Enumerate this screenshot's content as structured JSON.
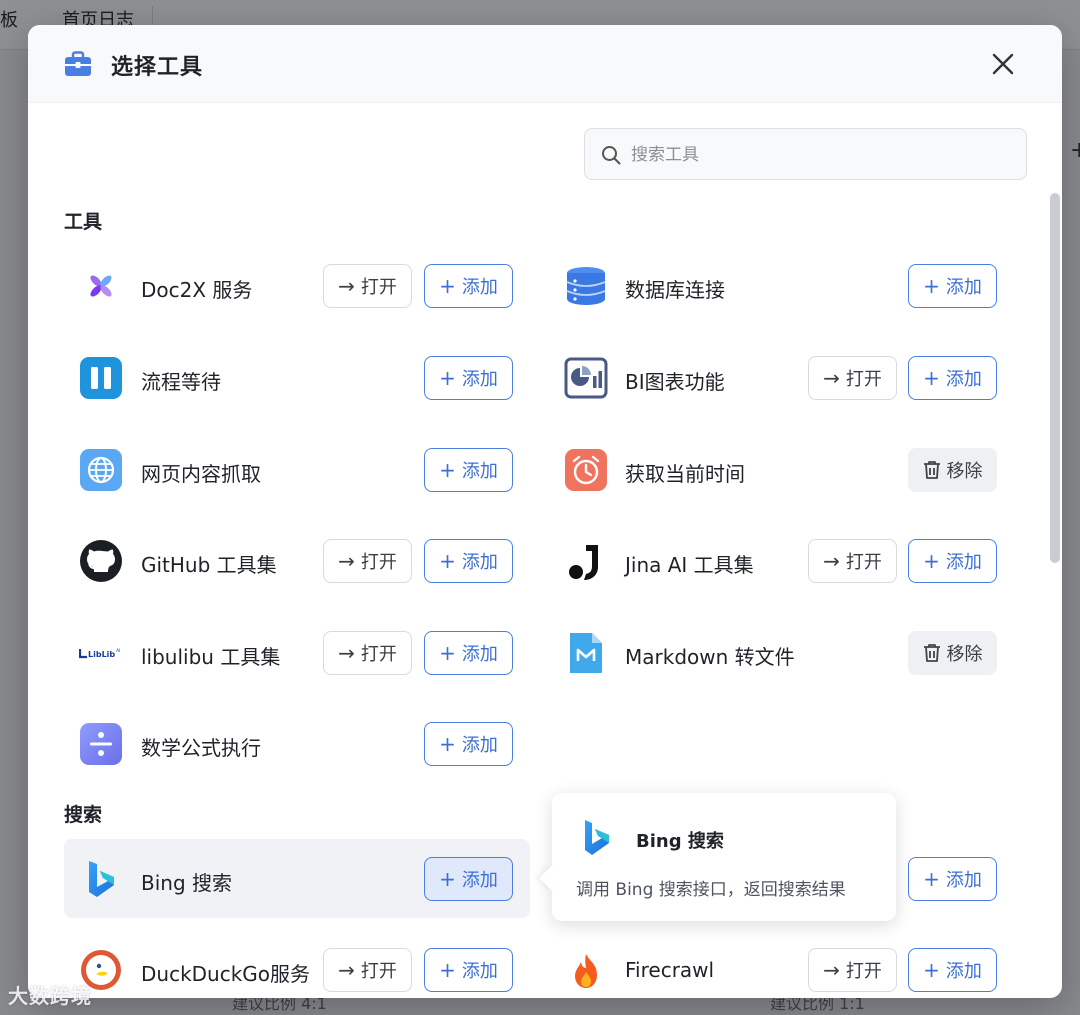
{
  "background": {
    "tabs": [
      "板",
      "首页日志"
    ],
    "plus_glyph": "+",
    "captions": [
      "建议比例 4:1",
      "建议比例 1:1"
    ]
  },
  "modal": {
    "title": "选择工具",
    "header_icon": "toolbox-icon",
    "close_icon": "close-icon"
  },
  "search": {
    "placeholder": "搜索工具",
    "value": ""
  },
  "sections": {
    "tools_label": "工具",
    "search_label": "搜索"
  },
  "buttons": {
    "open": "打开",
    "add": "添加",
    "remove": "移除"
  },
  "tools": [
    {
      "name": "Doc2X 服务",
      "icon": "doc2x-icon",
      "actions": [
        "open",
        "add"
      ]
    },
    {
      "name": "数据库连接",
      "icon": "database-icon",
      "actions": [
        "add"
      ]
    },
    {
      "name": "流程等待",
      "icon": "pause-icon",
      "actions": [
        "add"
      ]
    },
    {
      "name": "BI图表功能",
      "icon": "bi-chart-icon",
      "actions": [
        "open",
        "add"
      ]
    },
    {
      "name": "网页内容抓取",
      "icon": "globe-icon",
      "actions": [
        "add"
      ]
    },
    {
      "name": "获取当前时间",
      "icon": "alarm-clock-icon",
      "actions": [
        "remove"
      ]
    },
    {
      "name": "GitHub 工具集",
      "icon": "github-icon",
      "actions": [
        "open",
        "add"
      ]
    },
    {
      "name": "Jina AI 工具集",
      "icon": "jina-icon",
      "actions": [
        "open",
        "add"
      ]
    },
    {
      "name": "libulibu 工具集",
      "icon": "liblib-icon",
      "actions": [
        "open",
        "add"
      ]
    },
    {
      "name": "Markdown 转文件",
      "icon": "markdown-file-icon",
      "actions": [
        "remove"
      ]
    },
    {
      "name": "数学公式执行",
      "icon": "divide-icon",
      "actions": [
        "add"
      ]
    }
  ],
  "search_tools": [
    {
      "name": "Bing 搜索",
      "icon": "bing-icon",
      "actions": [
        "add"
      ],
      "hovered": true
    },
    {
      "name": "DuckDuckGo服务",
      "icon": "duckduckgo-icon",
      "actions": [
        "open",
        "add"
      ]
    },
    {
      "name": "Firecrawl",
      "icon": "firecrawl-icon",
      "actions": [
        "open",
        "add"
      ]
    }
  ],
  "tooltip": {
    "title": "Bing 搜索",
    "description": "调用 Bing 搜索接口，返回搜索结果",
    "icon": "bing-icon"
  },
  "watermark": "大数跨境",
  "colors": {
    "accent": "#3c6fd6",
    "accent_border": "#4a7ee0",
    "hover_bg": "#f0f2f5",
    "remove_bg": "#eef0f3"
  }
}
